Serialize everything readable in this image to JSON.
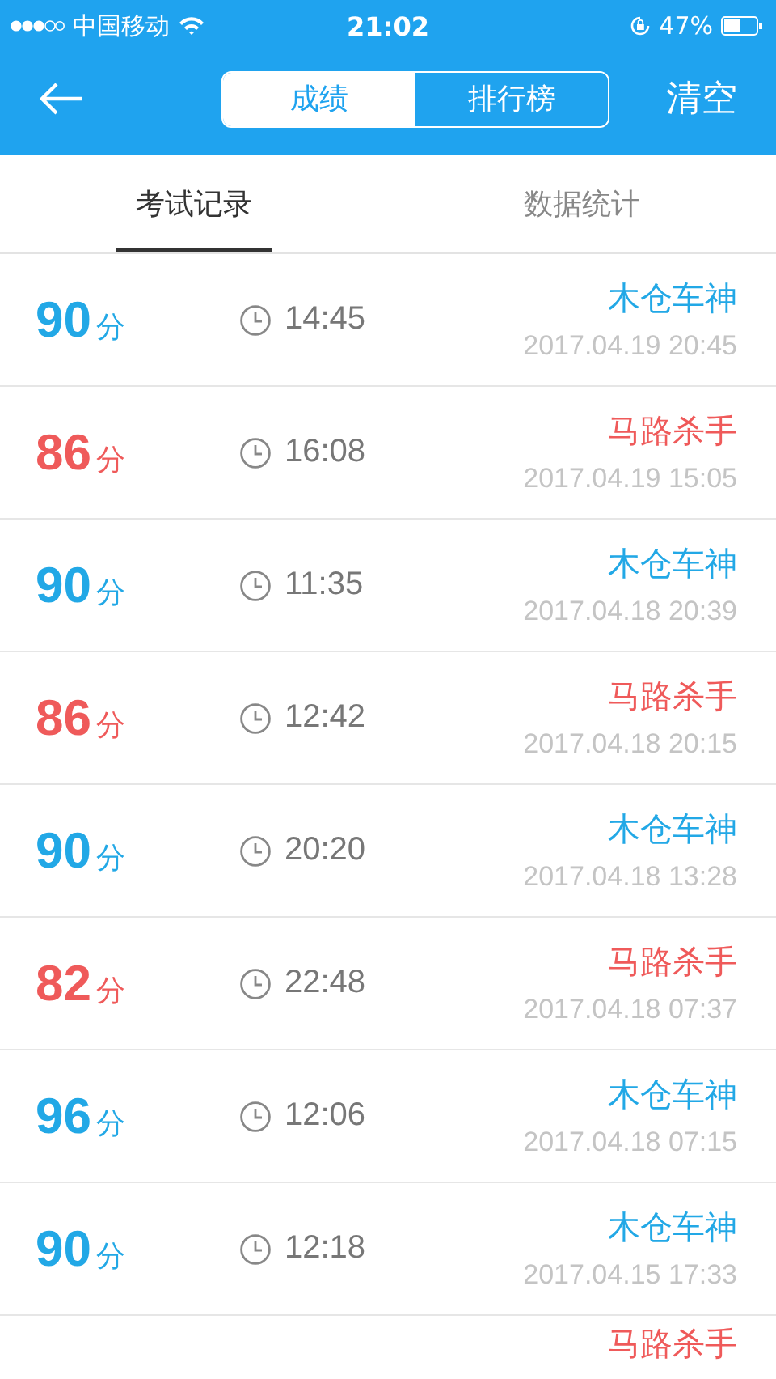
{
  "status_bar": {
    "carrier": "中国移动",
    "time": "21:02",
    "battery": "47%"
  },
  "nav": {
    "segments": [
      {
        "label": "成绩",
        "selected": true
      },
      {
        "label": "排行榜",
        "selected": false
      }
    ],
    "action": "清空"
  },
  "tabs": [
    {
      "label": "考试记录",
      "selected": true
    },
    {
      "label": "数据统计",
      "selected": false
    }
  ],
  "records": [
    {
      "score": "90",
      "unit": "分",
      "time": "14:45",
      "title": "木仓车神",
      "date": "2017.04.19 20:45",
      "color": "#22a8e6"
    },
    {
      "score": "86",
      "unit": "分",
      "time": "16:08",
      "title": "马路杀手",
      "date": "2017.04.19 15:05",
      "color": "#ef5a5a"
    },
    {
      "score": "90",
      "unit": "分",
      "time": "11:35",
      "title": "木仓车神",
      "date": "2017.04.18 20:39",
      "color": "#22a8e6"
    },
    {
      "score": "86",
      "unit": "分",
      "time": "12:42",
      "title": "马路杀手",
      "date": "2017.04.18 20:15",
      "color": "#ef5a5a"
    },
    {
      "score": "90",
      "unit": "分",
      "time": "20:20",
      "title": "木仓车神",
      "date": "2017.04.18 13:28",
      "color": "#22a8e6"
    },
    {
      "score": "82",
      "unit": "分",
      "time": "22:48",
      "title": "马路杀手",
      "date": "2017.04.18 07:37",
      "color": "#ef5a5a"
    },
    {
      "score": "96",
      "unit": "分",
      "time": "12:06",
      "title": "木仓车神",
      "date": "2017.04.18 07:15",
      "color": "#22a8e6"
    },
    {
      "score": "90",
      "unit": "分",
      "time": "12:18",
      "title": "木仓车神",
      "date": "2017.04.15 17:33",
      "color": "#22a8e6"
    },
    {
      "title": "马路杀手",
      "color": "#ef5a5a"
    }
  ]
}
